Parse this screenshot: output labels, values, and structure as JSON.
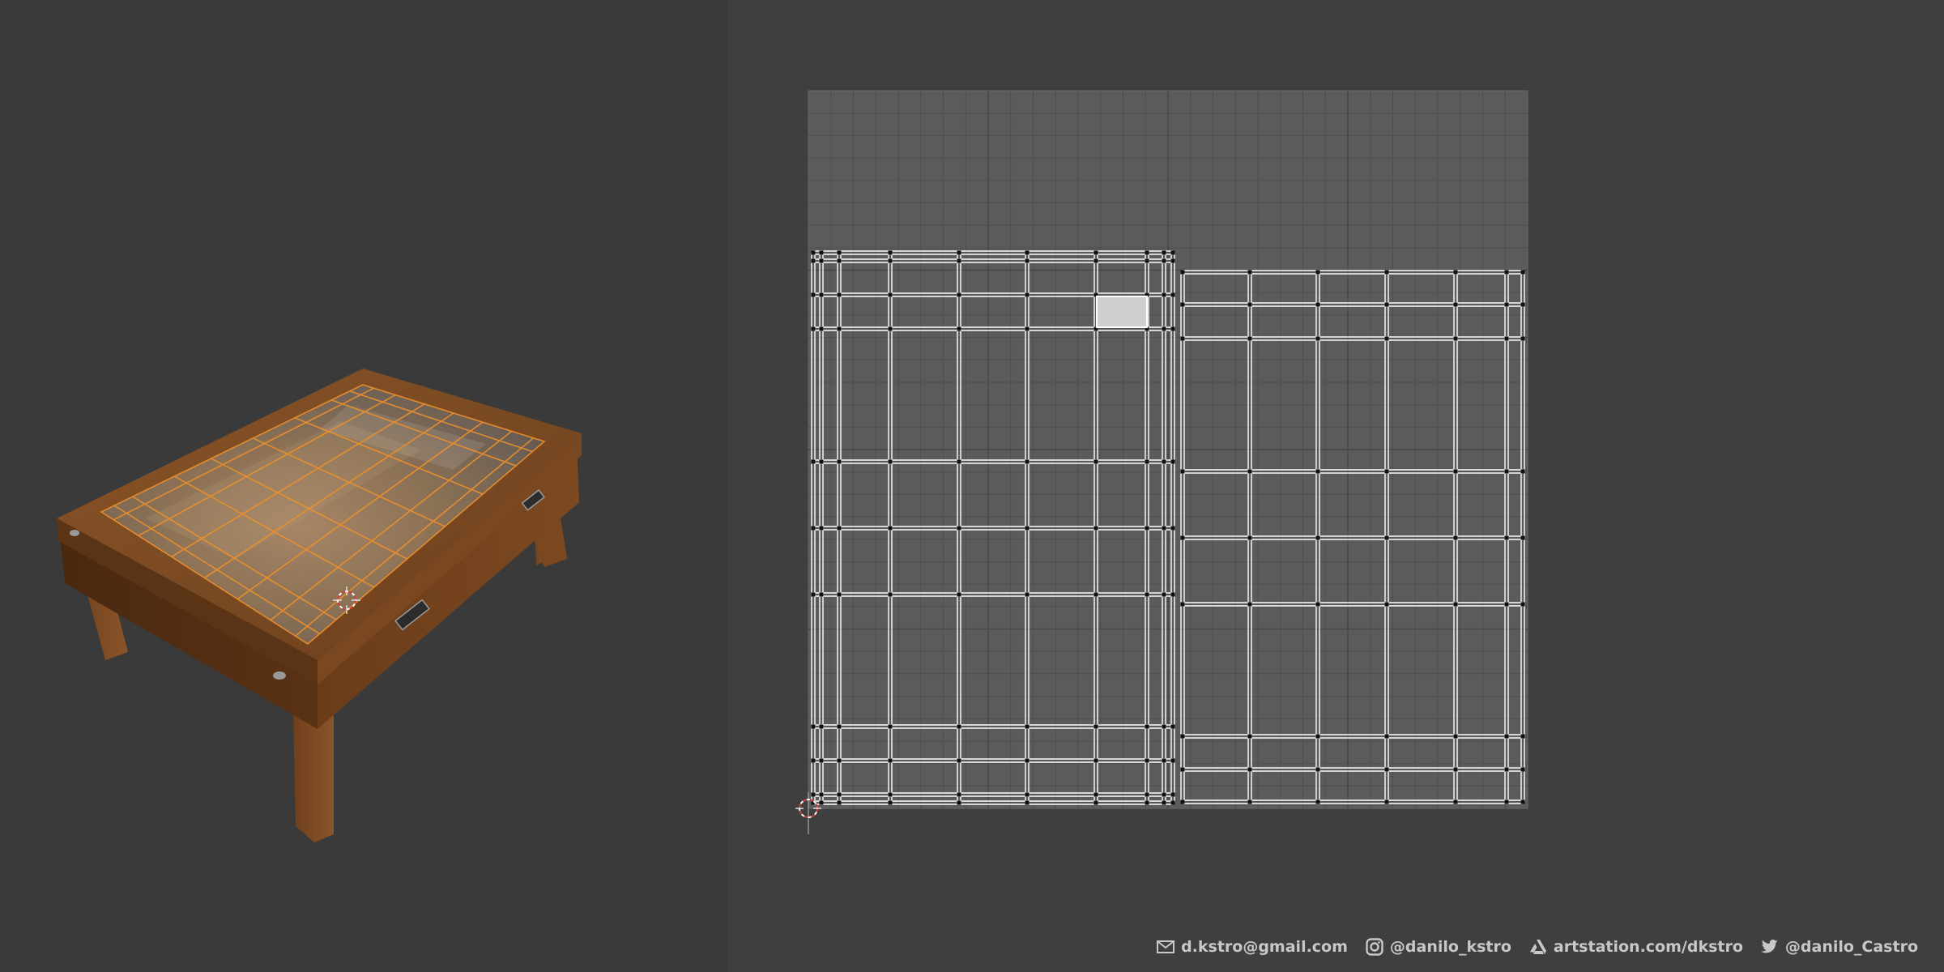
{
  "panels": {
    "viewport": {
      "name": "3d-viewport"
    },
    "uv_editor": {
      "name": "uv-editor"
    }
  },
  "contacts": [
    {
      "icon": "mail-icon",
      "label": "d.kstro@gmail.com"
    },
    {
      "icon": "instagram-icon",
      "label": "@danilo_kstro"
    },
    {
      "icon": "artstation-icon",
      "label": "artstation.com/dkstro"
    },
    {
      "icon": "twitter-icon",
      "label": "@danilo_Castro"
    }
  ],
  "colors": {
    "background": "#3d3d3d",
    "uv_grid": "#5b5b5b",
    "uv_edge": "#ffffff",
    "selected_face": "#cfcfcf",
    "wood": "#7a4a23",
    "mesh_overlay": "#f0902a",
    "cursor": "#d04040"
  }
}
